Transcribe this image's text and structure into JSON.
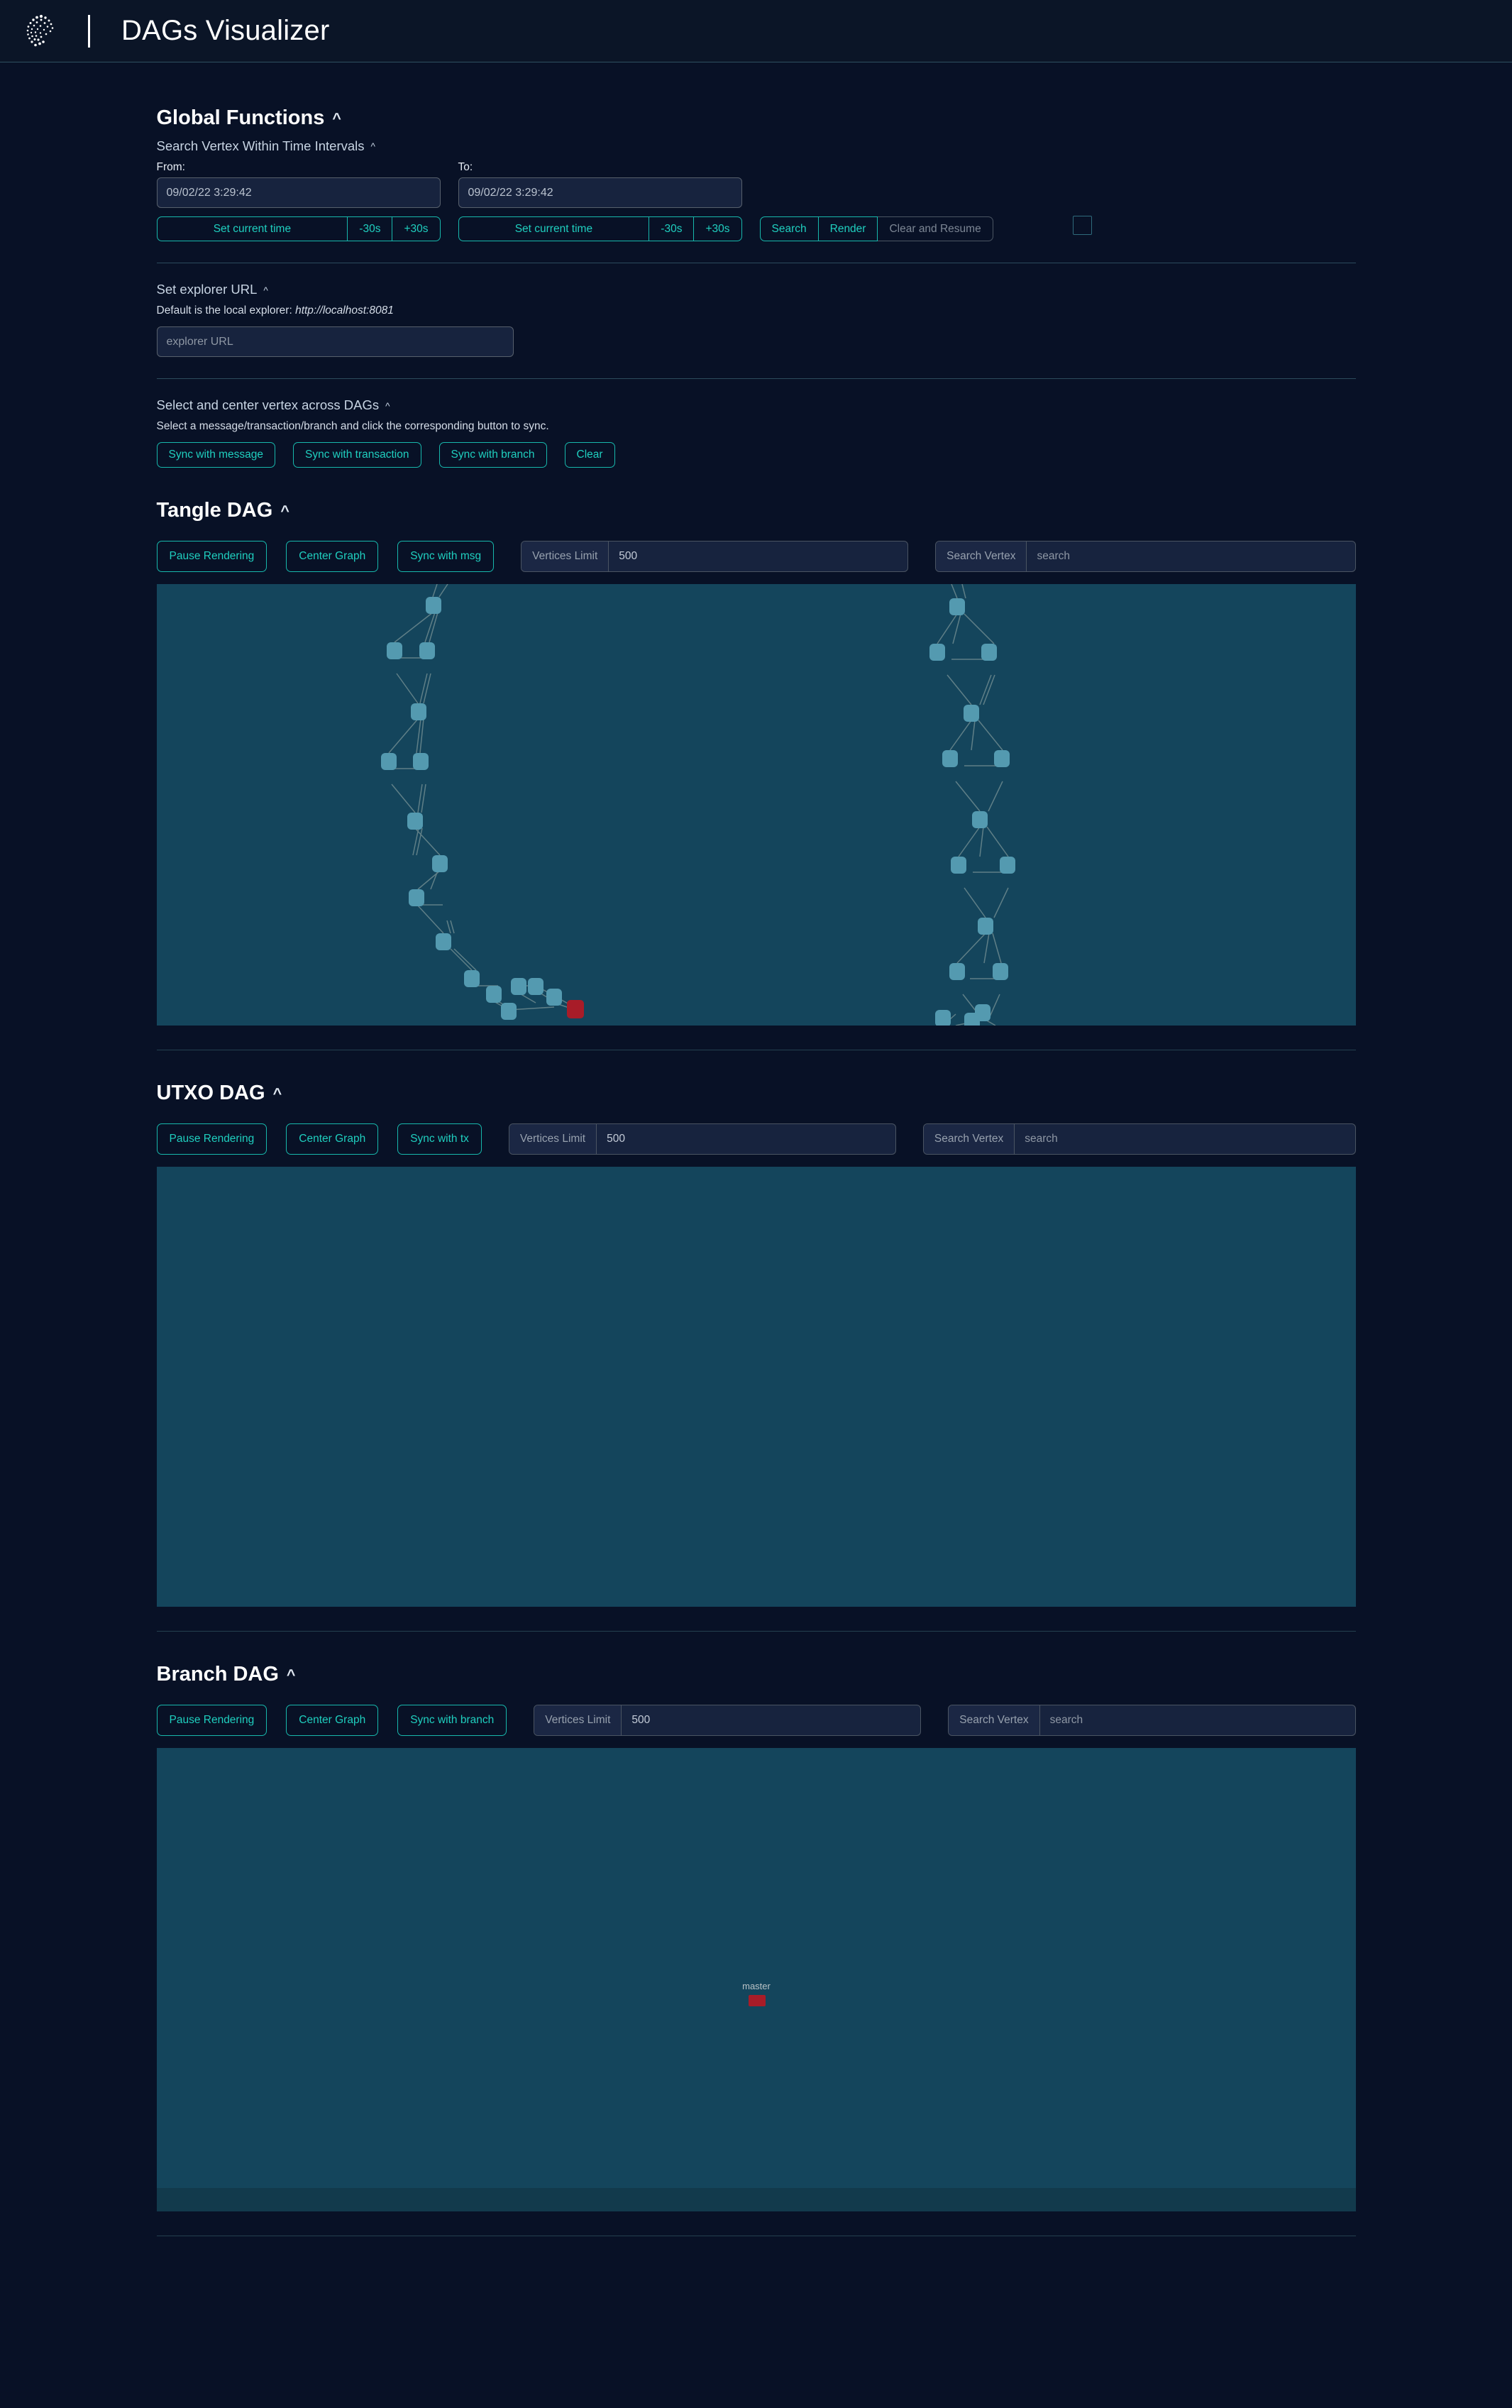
{
  "header": {
    "logo_icon": "iota-dots-logo",
    "title": "DAGs Visualizer"
  },
  "global_functions": {
    "title": "Global Functions",
    "collapse_icon": "chevron-up-icon",
    "time_search": {
      "title": "Search Vertex Within Time Intervals",
      "collapse_icon": "chevron-up-icon",
      "from_label": "From:",
      "to_label": "To:",
      "from_value": "09/02/22 3:29:42",
      "to_value": "09/02/22 3:29:42",
      "set_current_time_label": "Set current time",
      "minus_30s_label": "-30s",
      "plus_30s_label": "+30s",
      "search_label": "Search",
      "render_label": "Render",
      "clear_resume_label": "Clear and Resume",
      "clear_resume_disabled": true,
      "checkbox_checked": false
    },
    "explorer_url": {
      "title": "Set explorer URL",
      "collapse_icon": "chevron-up-icon",
      "description_prefix": "Default is the local explorer:",
      "description_url": "http://localhost:8081",
      "input_placeholder": "explorer URL",
      "input_value": ""
    },
    "sync_across": {
      "title": "Select and center vertex across DAGs",
      "collapse_icon": "chevron-up-icon",
      "description": "Select a message/transaction/branch and click the corresponding button to sync.",
      "buttons": [
        "Sync with message",
        "Sync with transaction",
        "Sync with branch",
        "Clear"
      ]
    }
  },
  "dags": [
    {
      "title": "Tangle DAG",
      "collapse_icon": "chevron-up-icon",
      "pause_label": "Pause Rendering",
      "center_label": "Center Graph",
      "sync_label": "Sync with msg",
      "vertices_limit_label": "Vertices Limit",
      "vertices_limit_value": "500",
      "search_vertex_label": "Search Vertex",
      "search_placeholder": "search",
      "search_value": ""
    },
    {
      "title": "UTXO DAG",
      "collapse_icon": "chevron-up-icon",
      "pause_label": "Pause Rendering",
      "center_label": "Center Graph",
      "sync_label": "Sync with tx",
      "vertices_limit_label": "Vertices Limit",
      "vertices_limit_value": "500",
      "search_vertex_label": "Search Vertex",
      "search_placeholder": "search",
      "search_value": ""
    },
    {
      "title": "Branch DAG",
      "collapse_icon": "chevron-up-icon",
      "pause_label": "Pause Rendering",
      "center_label": "Center Graph",
      "sync_label": "Sync with branch",
      "vertices_limit_label": "Vertices Limit",
      "vertices_limit_value": "500",
      "search_vertex_label": "Search Vertex",
      "search_placeholder": "search",
      "search_value": ""
    }
  ],
  "graph_colors": {
    "canvas_background": "#14455c",
    "node": "#549ab0",
    "node_selected": "#a81c28",
    "edge": "#5f7f87",
    "accent": "#1fcfbf",
    "page_background": "#081126"
  },
  "branch_graph": {
    "master_label": "master"
  }
}
